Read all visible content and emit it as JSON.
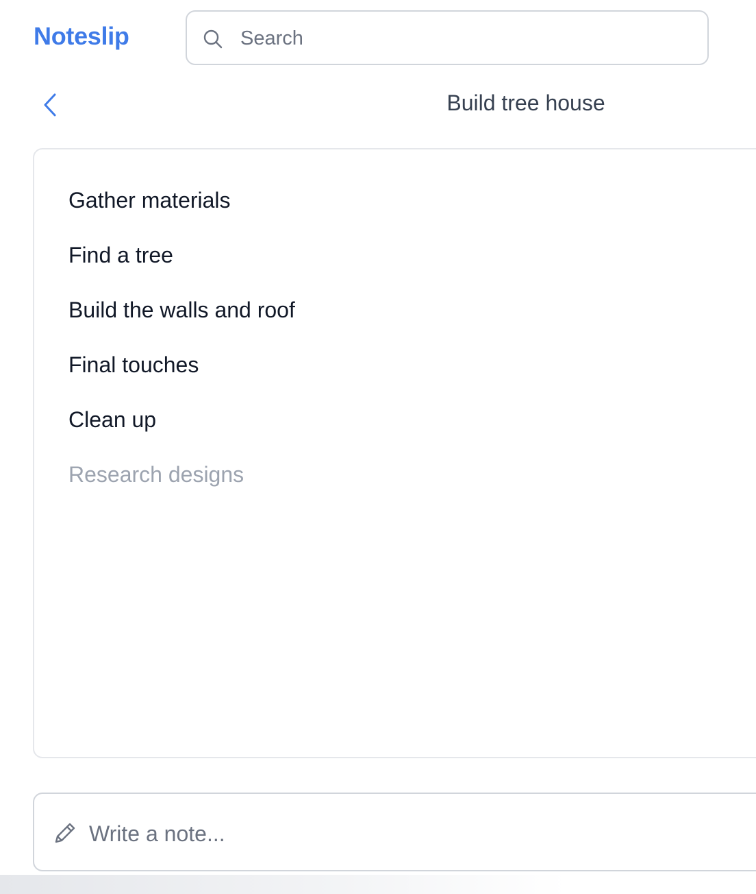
{
  "app": {
    "name": "Noteslip",
    "brand_color": "#3f7be8"
  },
  "search": {
    "placeholder": "Search",
    "value": "",
    "icon": "search-icon"
  },
  "header": {
    "back_icon": "chevron-left-icon",
    "title": "Build tree house"
  },
  "list": {
    "items": [
      {
        "label": "Gather materials",
        "muted": false
      },
      {
        "label": "Find a tree",
        "muted": false
      },
      {
        "label": "Build the walls and roof",
        "muted": false
      },
      {
        "label": "Final touches",
        "muted": false
      },
      {
        "label": "Clean up",
        "muted": false
      },
      {
        "label": "Research designs",
        "muted": true
      }
    ]
  },
  "composer": {
    "icon": "pencil-icon",
    "placeholder": "Write a note...",
    "value": ""
  }
}
